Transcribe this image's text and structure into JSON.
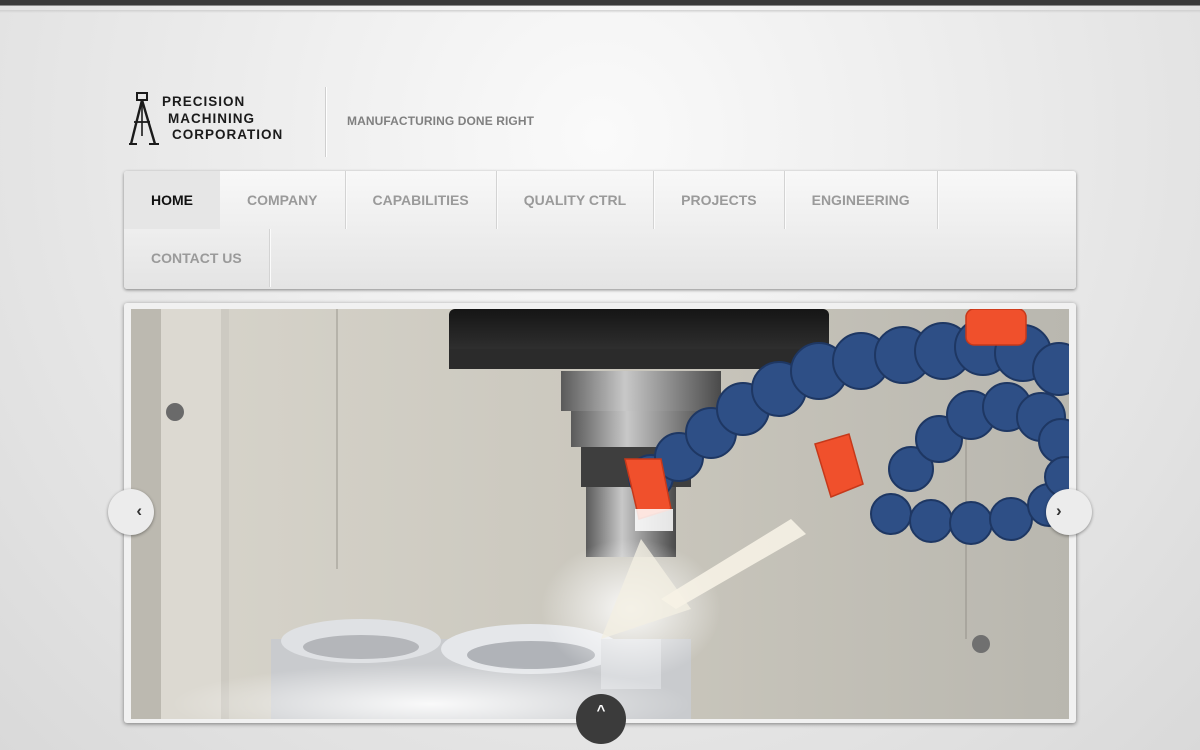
{
  "header": {
    "logo_lines": [
      "PRECISION",
      "MACHINING",
      "CORPORATION"
    ],
    "tagline": "MANUFACTURING DONE RIGHT"
  },
  "nav": {
    "row1": [
      {
        "label": "HOME",
        "active": true
      },
      {
        "label": "COMPANY"
      },
      {
        "label": "CAPABILITIES"
      },
      {
        "label": "QUALITY CTRL"
      },
      {
        "label": "PROJECTS"
      },
      {
        "label": "ENGINEERING"
      }
    ],
    "row2": [
      {
        "label": "CONTACT US"
      }
    ]
  },
  "slider": {
    "prev_icon": "chevron-left-icon",
    "next_icon": "chevron-right-icon",
    "prev_glyph": "‹",
    "next_glyph": "›"
  },
  "scroll_top": {
    "icon": "chevron-up-icon",
    "glyph": "^"
  },
  "colors": {
    "top_bar": "#3a3a3a",
    "nav_active_text": "#111111",
    "nav_text": "#9a9a9a",
    "tagline": "#808080",
    "coolant_hose": "#2e4f86",
    "nozzle": "#f0502c"
  }
}
